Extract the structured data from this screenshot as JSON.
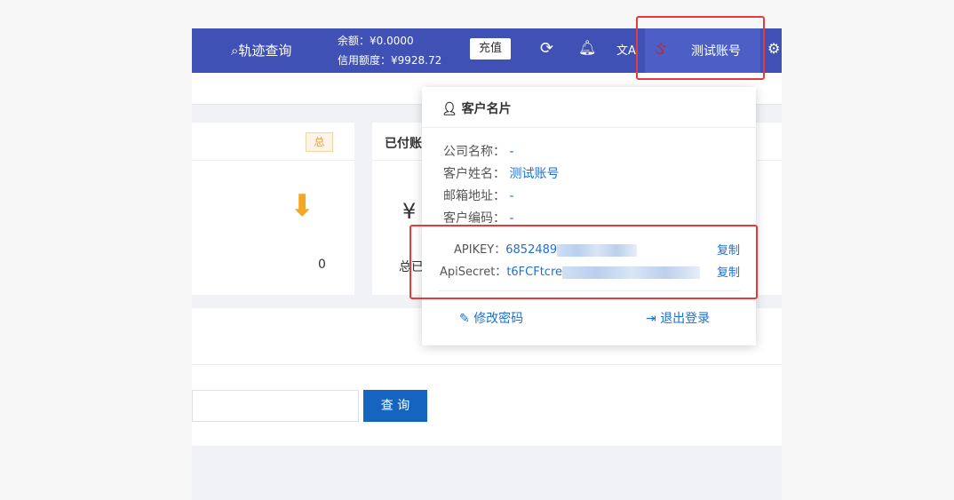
{
  "header": {
    "track_query": "轨迹查询",
    "balance": "余额：¥0.0000",
    "credit": "信用额度：¥9928.72",
    "recharge": "充值",
    "username": "测试账号"
  },
  "cards": [
    {
      "badge": "总",
      "value": "0"
    },
    {
      "title": "已付账",
      "symbol": "¥",
      "label": "总已"
    }
  ],
  "search": {
    "query_button": "查 询"
  },
  "popup": {
    "title": "客户名片",
    "fields": [
      {
        "label": "公司名称：",
        "value": "-"
      },
      {
        "label": "客户姓名：",
        "value": "测试账号"
      },
      {
        "label": "邮箱地址：",
        "value": "-"
      },
      {
        "label": "客户编码：",
        "value": "-"
      }
    ],
    "apikey_label": "APIKEY：",
    "apikey_value": "6852489",
    "apisecret_label": "ApiSecret：",
    "apisecret_value": "t6FCFtcre",
    "copy": "复制",
    "change_password": "修改密码",
    "logout": "退出登录"
  },
  "colors": {
    "header": "#3f51b5",
    "accent": "#1e6fd0",
    "highlight": "#e83a3a"
  }
}
